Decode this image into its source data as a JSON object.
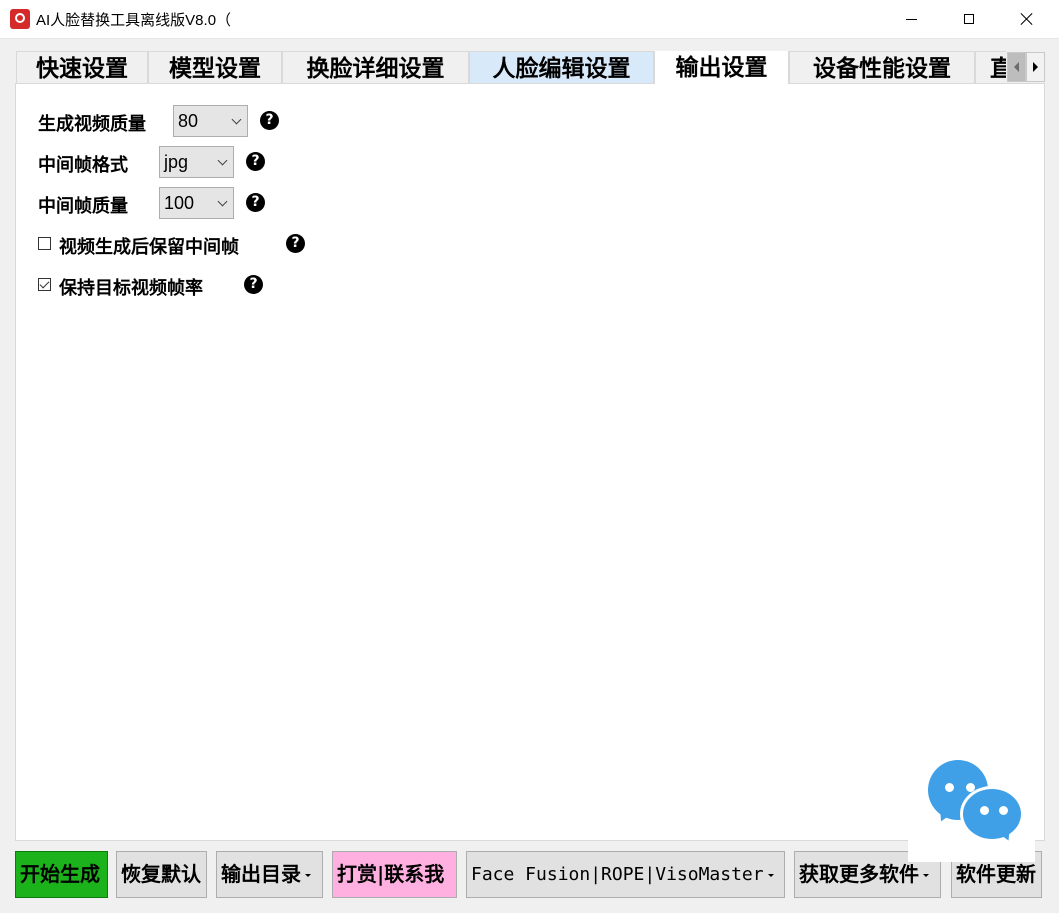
{
  "window": {
    "title": "AI人脸替换工具离线版V8.0（"
  },
  "tabs": [
    {
      "label": "快速设置"
    },
    {
      "label": "模型设置"
    },
    {
      "label": "换脸详细设置"
    },
    {
      "label": "人脸编辑设置"
    },
    {
      "label": "输出设置"
    },
    {
      "label": "设备性能设置"
    },
    {
      "label": "直"
    }
  ],
  "output_settings": {
    "video_quality": {
      "label": "生成视频质量",
      "value": "80"
    },
    "frame_format": {
      "label": "中间帧格式",
      "value": "jpg"
    },
    "frame_quality": {
      "label": "中间帧质量",
      "value": "100"
    },
    "keep_frames": {
      "label": "视频生成后保留中间帧",
      "checked": false
    },
    "keep_fps": {
      "label": "保持目标视频帧率",
      "checked": true
    },
    "help_glyph": "?"
  },
  "bottom_bar": {
    "start": "开始生成",
    "reset": "恢复默认",
    "output_dir": "输出目录",
    "donate": "打赏|联系我",
    "engine": "Face Fusion|ROPE|VisoMaster",
    "more_software": "获取更多软件",
    "update": "软件更新"
  },
  "colors": {
    "start_button": "#1bb21b",
    "donate_button": "#ffb0e0",
    "hover_tab": "#d8eaf9",
    "wechat_blue": "#3fa0e8"
  }
}
